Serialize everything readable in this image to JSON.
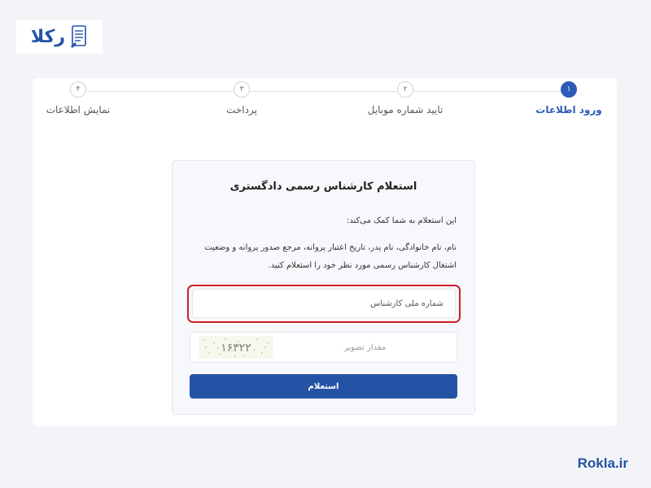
{
  "brand": {
    "logo_text": "رکلا",
    "footer": "Rokla.ir",
    "color": "#2453a6"
  },
  "stepper": {
    "steps": [
      {
        "number": "۱",
        "label": "ورود اطلاعات",
        "active": true
      },
      {
        "number": "۲",
        "label": "تایید شماره موبایل",
        "active": false
      },
      {
        "number": "۳",
        "label": "پرداخت",
        "active": false
      },
      {
        "number": "۴",
        "label": "نمایش اطلاعات",
        "active": false
      }
    ]
  },
  "form": {
    "title": "استعلام کارشناس رسمی دادگستری",
    "intro": "این استعلام به شما کمک می‌کند:",
    "description_line1": "نام، نام خانوادگی، نام پدر، تاریخ اعتبار پروانه، مرجع صدور پروانه و وضعیت",
    "description_line2": "اشتغال کارشناس رسمی مورد نظر خود را استعلام کنید.",
    "national_id_placeholder": "شماره ملی کارشناس",
    "captcha_placeholder": "مقدار تصویر",
    "captcha_code": "۱۶۳۲۲",
    "submit_label": "استعلام",
    "highlight_color": "#d0202a"
  }
}
